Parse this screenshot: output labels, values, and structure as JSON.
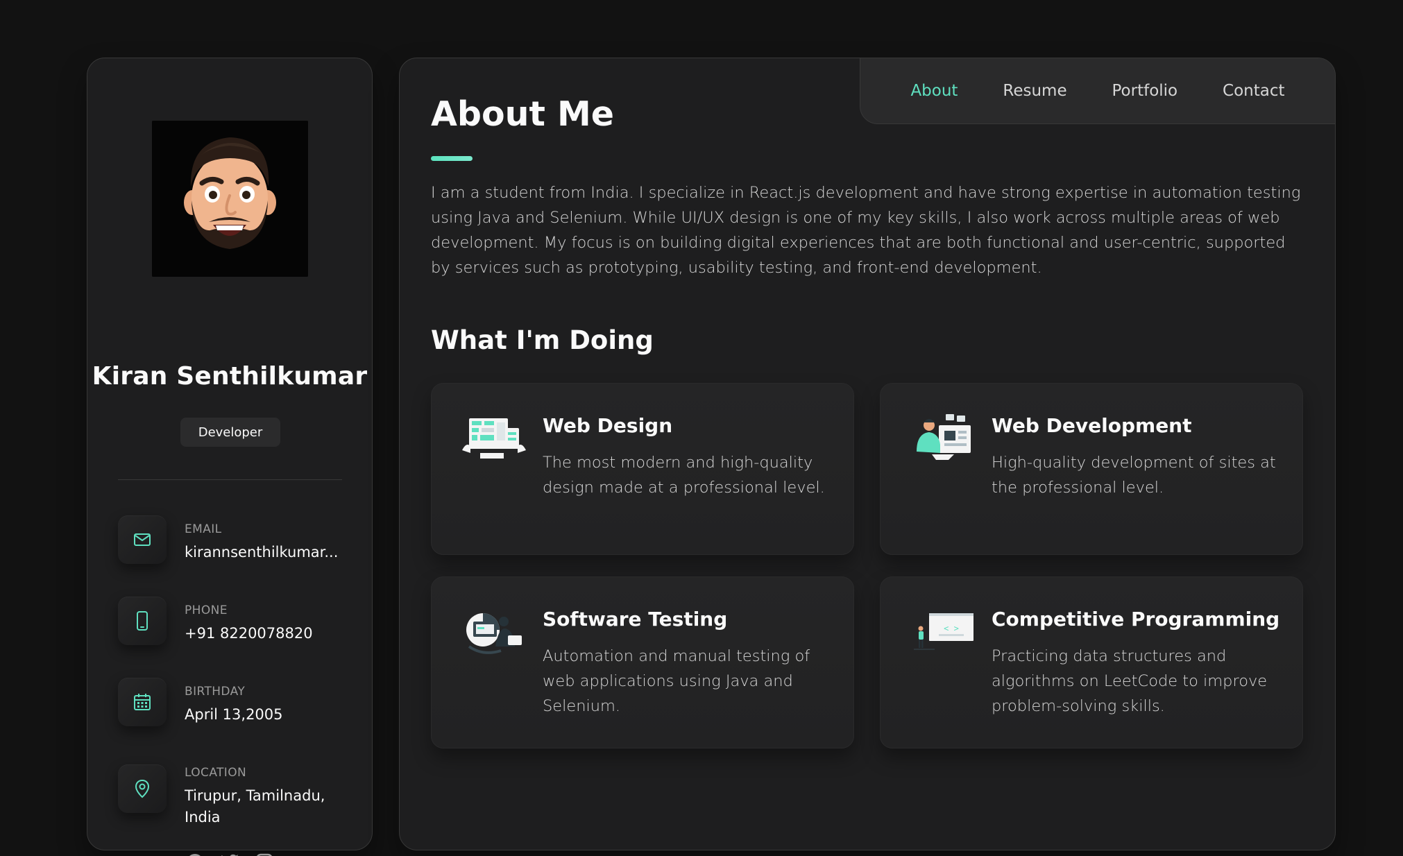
{
  "profile": {
    "name": "Kiran Senthilkumar",
    "title": "Developer"
  },
  "contacts": [
    {
      "label": "EMAIL",
      "value": "kirannsenthilkumar...",
      "icon": "mail-icon"
    },
    {
      "label": "PHONE",
      "value": "+91 8220078820",
      "icon": "phone-icon"
    },
    {
      "label": "BIRTHDAY",
      "value": "April 13,2005",
      "icon": "calendar-icon"
    },
    {
      "label": "LOCATION",
      "value": "Tirupur, Tamilnadu, India",
      "icon": "location-pin-icon"
    }
  ],
  "social": [
    "facebook-icon",
    "twitter-icon",
    "instagram-icon"
  ],
  "nav": {
    "items": [
      "About",
      "Resume",
      "Portfolio",
      "Contact"
    ],
    "active": "About"
  },
  "about": {
    "title": "About Me",
    "text": "I am a student from India. I specialize in React.js development and have strong expertise in automation testing using Java and Selenium. While UI/UX design is one of my key skills, I also work across multiple areas of web development. My focus is on building digital experiences that are both functional and user-centric, supported by services such as prototyping, usability testing, and front-end development."
  },
  "services": {
    "title": "What I'm Doing",
    "items": [
      {
        "title": "Web Design",
        "text": "The most modern and high-quality design made at a professional level.",
        "icon": "web-design-icon"
      },
      {
        "title": "Web Development",
        "text": "High-quality development of sites at the professional level.",
        "icon": "web-development-icon"
      },
      {
        "title": "Software Testing",
        "text": "Automation and manual testing of web applications using Java and Selenium.",
        "icon": "software-testing-icon"
      },
      {
        "title": "Competitive Programming",
        "text": "Practicing data structures and algorithms on LeetCode to improve problem-solving skills.",
        "icon": "competitive-programming-icon"
      }
    ]
  },
  "colors": {
    "background": "#121212",
    "card": "#1e1e1f",
    "accent": "#5fe0c0",
    "text": "#fafafa",
    "muted": "#d6d6d6"
  }
}
